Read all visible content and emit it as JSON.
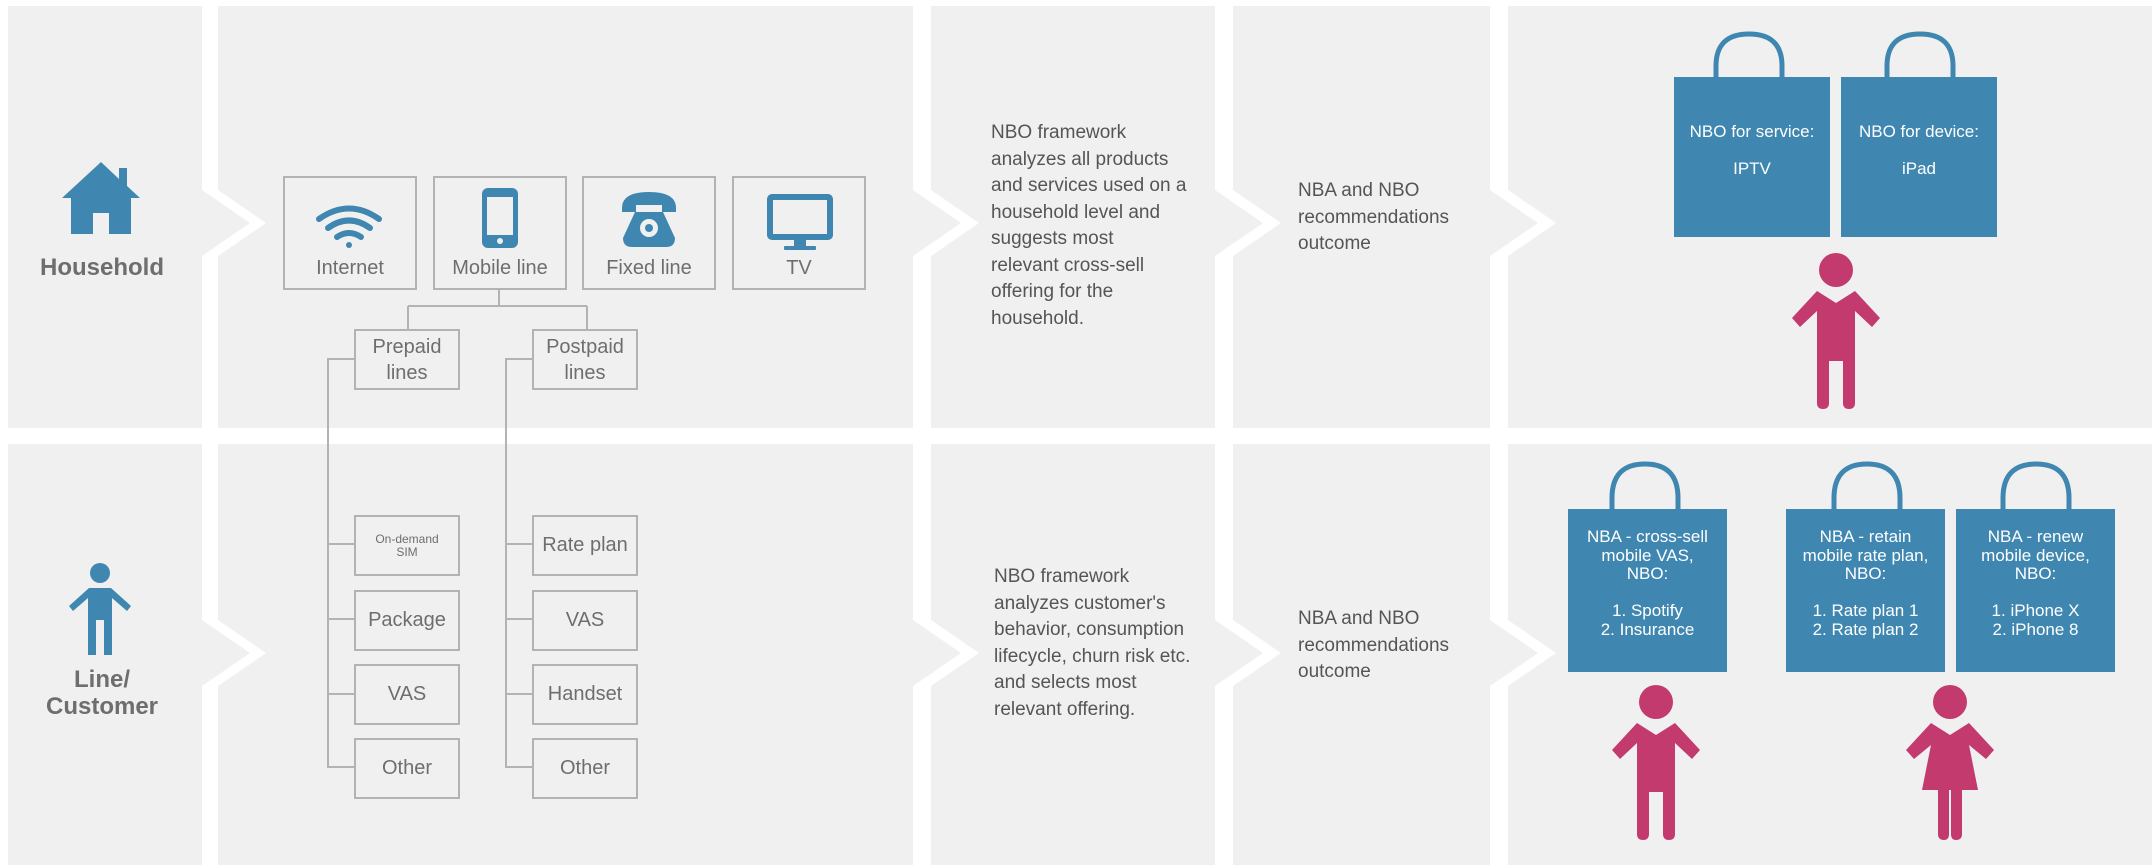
{
  "colors": {
    "panel": "#f0f0f0",
    "accent_blue": "#3f87b0",
    "accent_pink": "#c23a6e",
    "box_border": "#b3b3b3",
    "text_gray": "#6e6e6e"
  },
  "household": {
    "label": "Household",
    "services": [
      "Internet",
      "Mobile line",
      "Fixed line",
      "TV"
    ],
    "line_types": [
      "Prepaid\nlines",
      "Postpaid\nlines"
    ],
    "description": "NBO framework\nanalyzes all products\nand services used on a\nhousehold level and\nsuggests most\nrelevant cross-sell\noffering for the\nhousehold.",
    "outcome": "NBA and NBO\nrecommendations\noutcome",
    "offers": [
      "NBO for service:\n\nIPTV",
      "NBO for device:\n\niPad"
    ]
  },
  "customer": {
    "label": "Line/\nCustomer",
    "prepaid_items": [
      "On-demand\nSIM",
      "Package",
      "VAS",
      "Other"
    ],
    "postpaid_items": [
      "Rate plan",
      "VAS",
      "Handset",
      "Other"
    ],
    "description": "NBO framework\nanalyzes customer's\nbehavior, consumption\nlifecycle, churn risk etc.\nand selects most\nrelevant offering.",
    "outcome": "NBA and NBO\nrecommendations\noutcome",
    "offers": [
      "NBA - cross-sell\nmobile VAS,\nNBO:\n\n1. Spotify\n2. Insurance",
      "NBA - retain\nmobile rate plan,\nNBO:\n\n1. Rate plan 1\n2. Rate plan 2",
      "NBA - renew\nmobile device,\nNBO:\n\n1. iPhone X\n2. iPhone 8"
    ]
  }
}
